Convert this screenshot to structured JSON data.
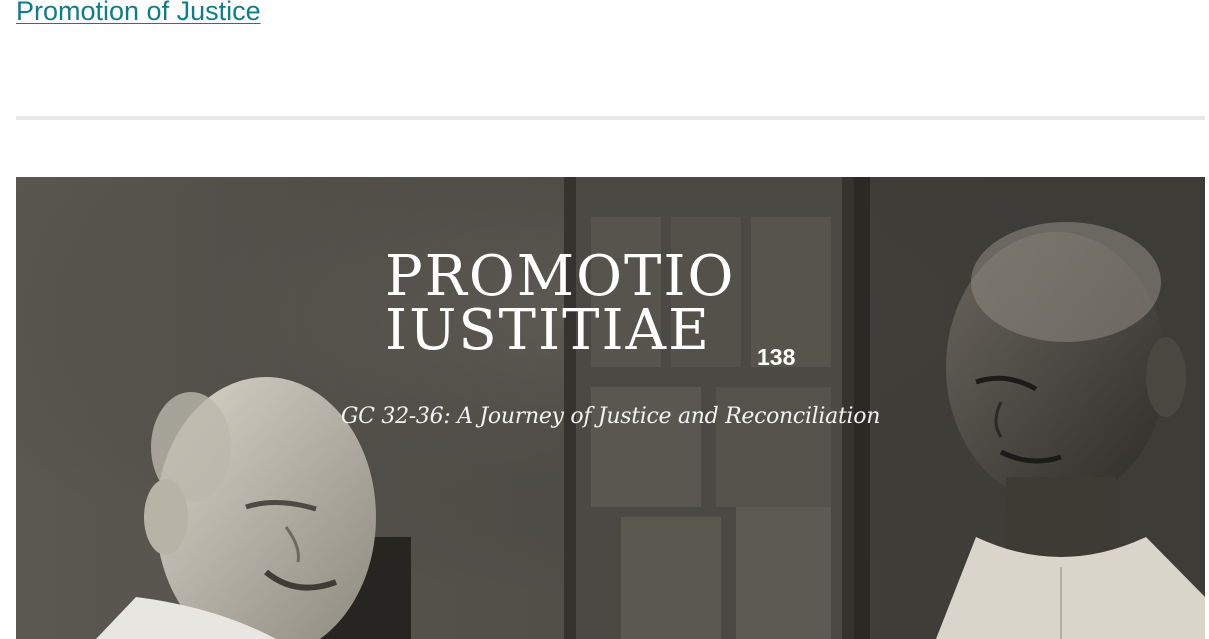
{
  "header": {
    "link_text": "Promotion of Justice",
    "link_color": "#0a7e8c"
  },
  "banner": {
    "title_line1": "PROMOTIO",
    "title_line2": "IUSTITIAE",
    "issue_number": "138",
    "subtitle": "GC 32-36: A Journey of Justice and Reconciliation",
    "image_description_icon": "photo-two-men-icon"
  }
}
